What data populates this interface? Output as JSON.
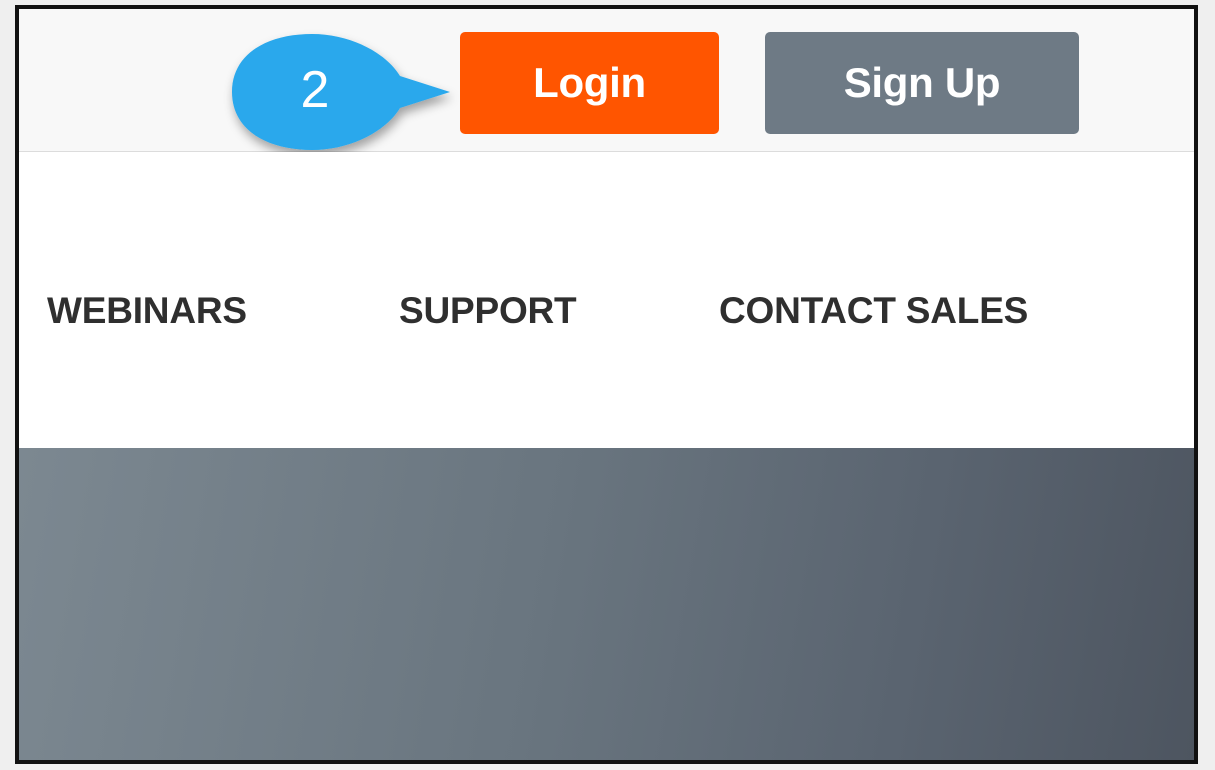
{
  "header": {
    "login_label": "Login",
    "signup_label": "Sign Up"
  },
  "nav": {
    "items": [
      {
        "label": "WEBINARS"
      },
      {
        "label": "SUPPORT"
      },
      {
        "label": "CONTACT SALES"
      }
    ]
  },
  "callout": {
    "number": "2",
    "icon": "arrow-pointer-callout",
    "color": "#29a8ec"
  },
  "colors": {
    "login_bg": "#ff5500",
    "signup_bg": "#6e7a85",
    "nav_text": "#2f2f2f"
  }
}
